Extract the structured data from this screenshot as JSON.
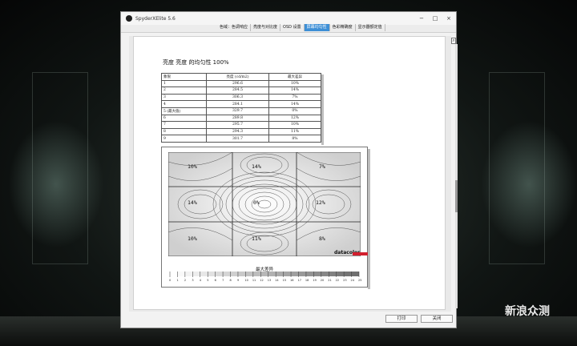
{
  "window": {
    "title": "SpyderXElite 5.6"
  },
  "tabs": [
    {
      "label": "色域：色调响应",
      "active": false
    },
    {
      "label": "亮度与对比度",
      "active": false
    },
    {
      "label": "OSD 设置",
      "active": false
    },
    {
      "label": "屏幕均匀性",
      "active": true
    },
    {
      "label": "色彩精确度",
      "active": false
    },
    {
      "label": "显示器额定值",
      "active": false
    }
  ],
  "report": {
    "title": "亮度 亮度 的均匀性 100%",
    "columns": [
      "象限",
      "亮度 (cd/m2)",
      "最大差异"
    ],
    "rows": [
      [
        "1",
        "296.6",
        "10%"
      ],
      [
        "2",
        "284.5",
        "14%"
      ],
      [
        "3",
        "306.3",
        "7%"
      ],
      [
        "4",
        "284.1",
        "14%"
      ],
      [
        "5 (最大值)",
        "329.7",
        "0%"
      ],
      [
        "6",
        "289.8",
        "12%"
      ],
      [
        "7",
        "295.7",
        "10%"
      ],
      [
        "8",
        "294.3",
        "11%"
      ],
      [
        "9",
        "301.7",
        "8%"
      ]
    ]
  },
  "uniformity_map": {
    "cells": [
      "10%",
      "14%",
      "7%",
      "14%",
      "0%",
      "12%",
      "10%",
      "11%",
      "8%"
    ],
    "logo": "datacolor",
    "legend_title": "最大差异",
    "legend_ticks": [
      "0",
      "1",
      "2",
      "3",
      "4",
      "5",
      "6",
      "7",
      "8",
      "9",
      "10",
      "11",
      "12",
      "13",
      "14",
      "15",
      "16",
      "17",
      "18",
      "19",
      "20",
      "21",
      "22",
      "23",
      "24",
      "25"
    ]
  },
  "buttons": {
    "print": "打印",
    "close": "关闭"
  },
  "watermark": {
    "text": "新浪众测"
  }
}
